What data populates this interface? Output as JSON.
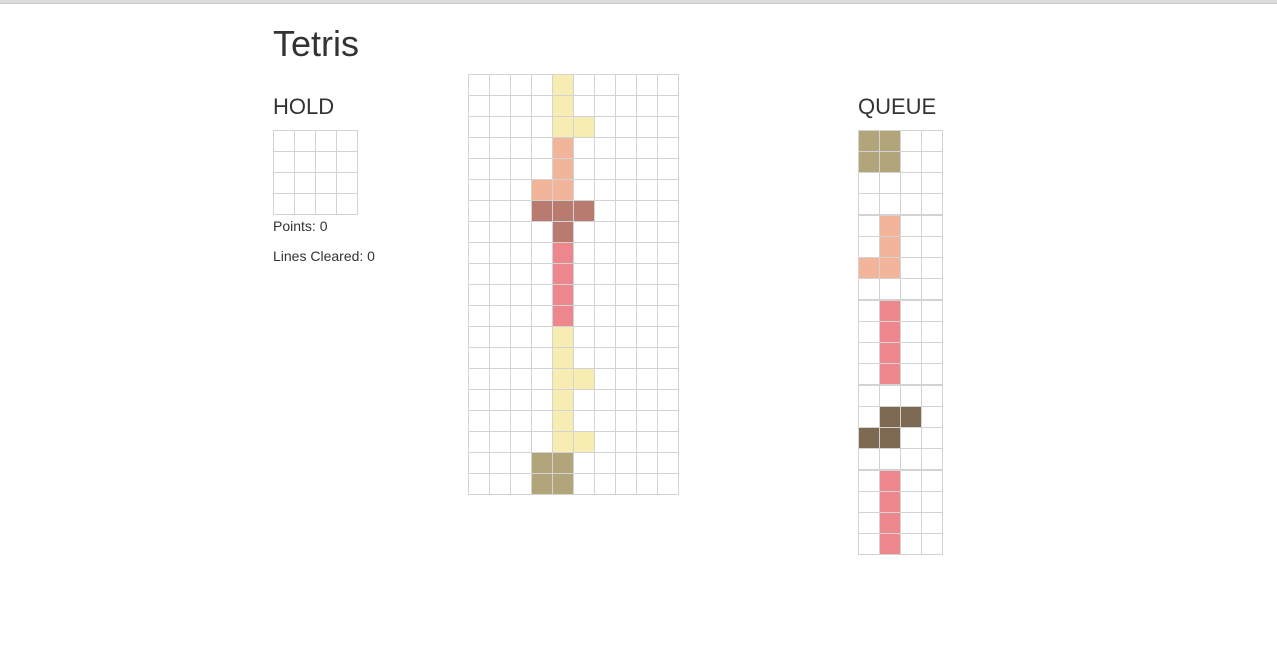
{
  "title": "Tetris",
  "hold": {
    "label": "HOLD",
    "grid": [
      "....",
      "....",
      "....",
      "...."
    ]
  },
  "stats": {
    "points": "Points: 0",
    "lines": "Lines Cleared: 0"
  },
  "queue": {
    "label": "QUEUE",
    "pieces": [
      [
        "OO..",
        "OO..",
        "....",
        "...."
      ],
      [
        ".L..",
        ".L..",
        "LL..",
        "...."
      ],
      [
        ".I..",
        ".I..",
        ".I..",
        ".I.."
      ],
      [
        "....",
        ".SS.",
        "SS..",
        "...."
      ],
      [
        ".I..",
        ".I..",
        ".I..",
        ".I.."
      ]
    ]
  },
  "board": {
    "columns": 10,
    "rows": [
      "....Y.....",
      "....Y.....",
      "....YY....",
      "....L.....",
      "....L.....",
      "...LL.....",
      "...TTT....",
      "....T.....",
      "....I.....",
      "....I.....",
      "....I.....",
      "....I.....",
      "....Y.....",
      "....Y.....",
      "....YY....",
      "....Y.....",
      "....Y.....",
      "....YY....",
      "...OO.....",
      "...OO....."
    ]
  },
  "colors": {
    "empty": "#ffffff",
    "O": "#b3a57a",
    "L": "#f2b599",
    "I": "#ee868d",
    "T": "#b97b6f",
    "S": "#7e6a53",
    "Y": "#f7edb3",
    "grid_line": "#d3d3d3"
  }
}
